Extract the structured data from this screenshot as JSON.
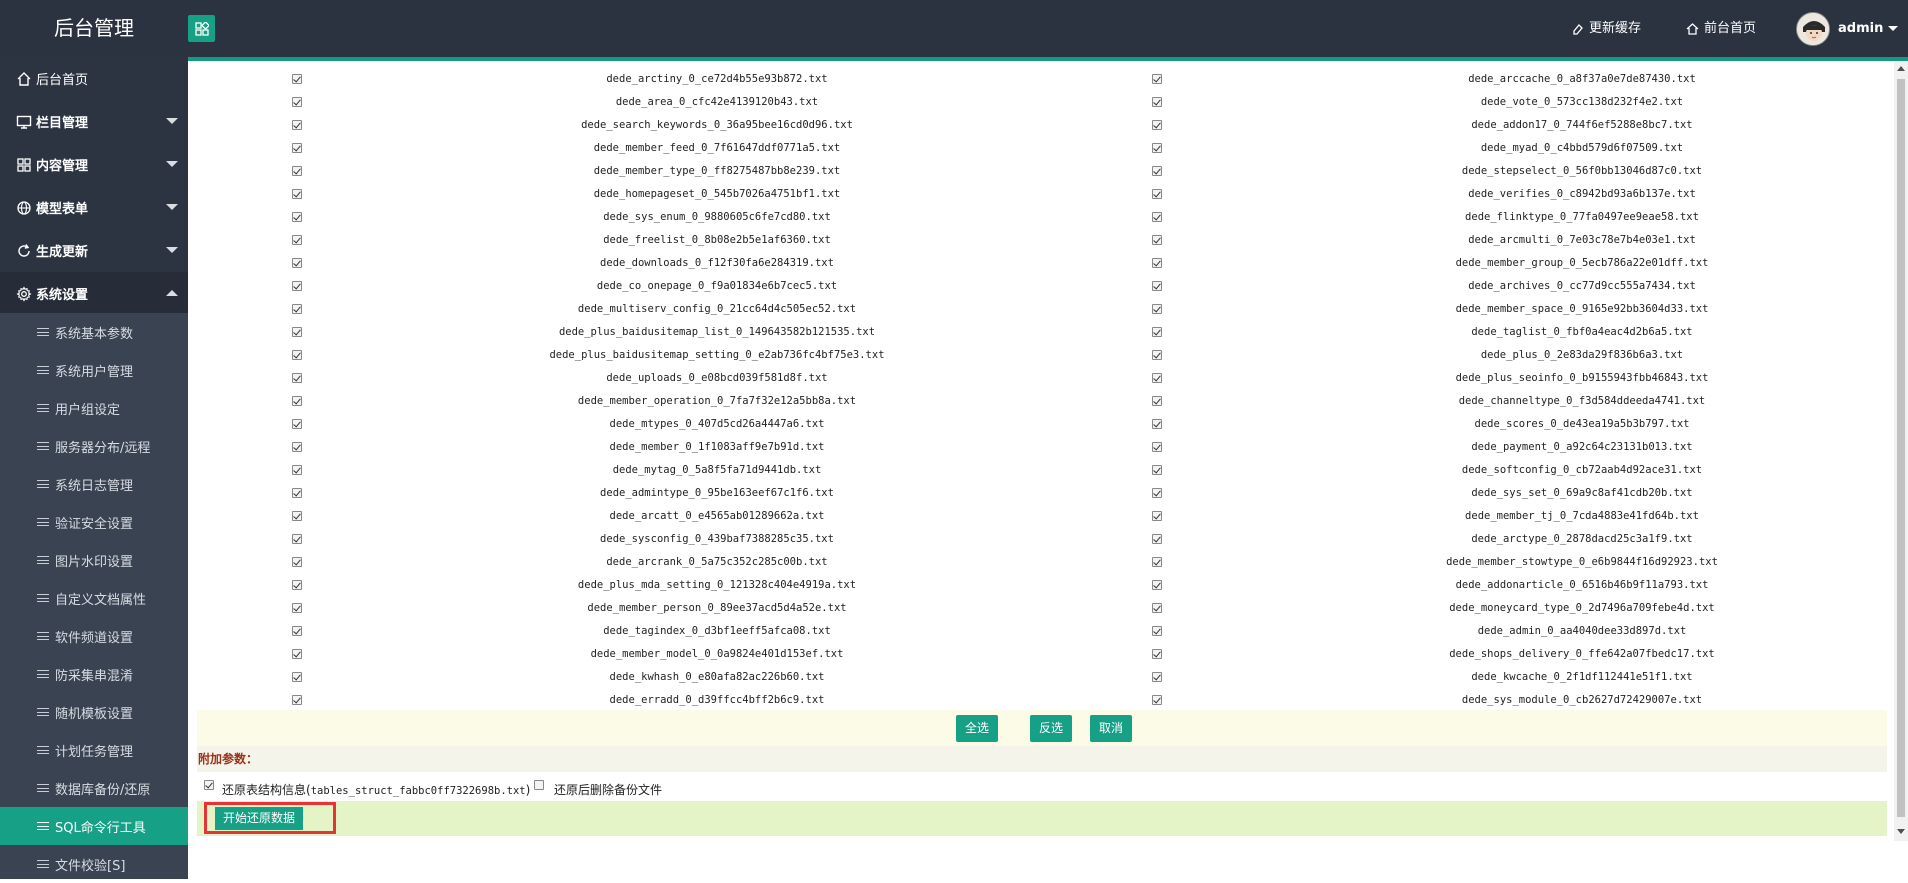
{
  "header": {
    "brand": "后台管理",
    "clear_cache": "更新缓存",
    "front_home": "前台首页",
    "user": "admin"
  },
  "sidebar": {
    "items": [
      {
        "label": "后台首页",
        "icon": "home-icon",
        "has_caret": false
      },
      {
        "label": "栏目管理",
        "icon": "monitor-icon",
        "has_caret": true
      },
      {
        "label": "内容管理",
        "icon": "grid-icon",
        "has_caret": true
      },
      {
        "label": "模型表单",
        "icon": "globe-icon",
        "has_caret": true
      },
      {
        "label": "生成更新",
        "icon": "refresh-icon",
        "has_caret": true
      },
      {
        "label": "系统设置",
        "icon": "gear-icon",
        "has_caret": true,
        "expanded": true
      }
    ],
    "sub_items": [
      "系统基本参数",
      "系统用户管理",
      "用户组设定",
      "服务器分布/远程",
      "系统日志管理",
      "验证安全设置",
      "图片水印设置",
      "自定义文档属性",
      "软件频道设置",
      "防采集串混淆",
      "随机模板设置",
      "计划任务管理",
      "数据库备份/还原",
      "SQL命令行工具",
      "文件校验[S]"
    ],
    "active_sub_item": "SQL命令行工具"
  },
  "files": {
    "left": [
      "dede_arctiny_0_ce72d4b55e93b872.txt",
      "dede_area_0_cfc42e4139120b43.txt",
      "dede_search_keywords_0_36a95bee16cd0d96.txt",
      "dede_member_feed_0_7f61647ddf0771a5.txt",
      "dede_member_type_0_ff8275487bb8e239.txt",
      "dede_homepageset_0_545b7026a4751bf1.txt",
      "dede_sys_enum_0_9880605c6fe7cd80.txt",
      "dede_freelist_0_8b08e2b5e1af6360.txt",
      "dede_downloads_0_f12f30fa6e284319.txt",
      "dede_co_onepage_0_f9a01834e6b7cec5.txt",
      "dede_multiserv_config_0_21cc64d4c505ec52.txt",
      "dede_plus_baidusitemap_list_0_149643582b121535.txt",
      "dede_plus_baidusitemap_setting_0_e2ab736fc4bf75e3.txt",
      "dede_uploads_0_e08bcd039f581d8f.txt",
      "dede_member_operation_0_7fa7f32e12a5bb8a.txt",
      "dede_mtypes_0_407d5cd26a4447a6.txt",
      "dede_member_0_1f1083aff9e7b91d.txt",
      "dede_mytag_0_5a8f5fa71d9441db.txt",
      "dede_admintype_0_95be163eef67c1f6.txt",
      "dede_arcatt_0_e4565ab01289662a.txt",
      "dede_sysconfig_0_439baf7388285c35.txt",
      "dede_arcrank_0_5a75c352c285c00b.txt",
      "dede_plus_mda_setting_0_121328c404e4919a.txt",
      "dede_member_person_0_89ee37acd5d4a52e.txt",
      "dede_tagindex_0_d3bf1eeff5afca08.txt",
      "dede_member_model_0_0a9824e401d153ef.txt",
      "dede_kwhash_0_e80afa82ac226b60.txt",
      "dede_erradd_0_d39ffcc4bff2b6c9.txt"
    ],
    "right": [
      "dede_arccache_0_a8f37a0e7de87430.txt",
      "dede_vote_0_573cc138d232f4e2.txt",
      "dede_addon17_0_744f6ef5288e8bc7.txt",
      "dede_myad_0_c4bbd579d6f07509.txt",
      "dede_stepselect_0_56f0bb13046d87c0.txt",
      "dede_verifies_0_c8942bd93a6b137e.txt",
      "dede_flinktype_0_77fa0497ee9eae58.txt",
      "dede_arcmulti_0_7e03c78e7b4e03e1.txt",
      "dede_member_group_0_5ecb786a22e01dff.txt",
      "dede_archives_0_cc77d9cc555a7434.txt",
      "dede_member_space_0_9165e92bb3604d33.txt",
      "dede_taglist_0_fbf0a4eac4d2b6a5.txt",
      "dede_plus_0_2e83da29f836b6a3.txt",
      "dede_plus_seoinfo_0_b9155943fbb46843.txt",
      "dede_channeltype_0_f3d584ddeeda4741.txt",
      "dede_scores_0_de43ea19a5b3b797.txt",
      "dede_payment_0_a92c64c23131b013.txt",
      "dede_softconfig_0_cb72aab4d92ace31.txt",
      "dede_sys_set_0_69a9c8af41cdb20b.txt",
      "dede_member_tj_0_7cda4883e41fd64b.txt",
      "dede_arctype_0_2878dacd25c3a1f9.txt",
      "dede_member_stowtype_0_e6b9844f16d92923.txt",
      "dede_addonarticle_0_6516b46b9f11a793.txt",
      "dede_moneycard_type_0_2d7496a709febe4d.txt",
      "dede_admin_0_aa4040dee33d897d.txt",
      "dede_shops_delivery_0_ffe642a07fbedc17.txt",
      "dede_kwcache_0_2f1df112441e51f1.txt",
      "dede_sys_module_0_cb2627d72429007e.txt"
    ]
  },
  "actions": {
    "select_all": "全选",
    "invert": "反选",
    "cancel": "取消"
  },
  "params": {
    "title": "附加参数：",
    "restore_struct_prefix": "还原表结构信息(",
    "restore_struct_file": "tables_struct_fabbc0ff7322698b.txt",
    "restore_struct_suffix": ")",
    "restore_struct_checked": true,
    "delete_after": "还原后删除备份文件",
    "delete_after_checked": false
  },
  "submit": {
    "label": "开始还原数据"
  },
  "colors": {
    "accent": "#16a085",
    "header_bg": "#2b3240",
    "sidebar_bg": "#2c3441",
    "highlight": "#e63333"
  }
}
